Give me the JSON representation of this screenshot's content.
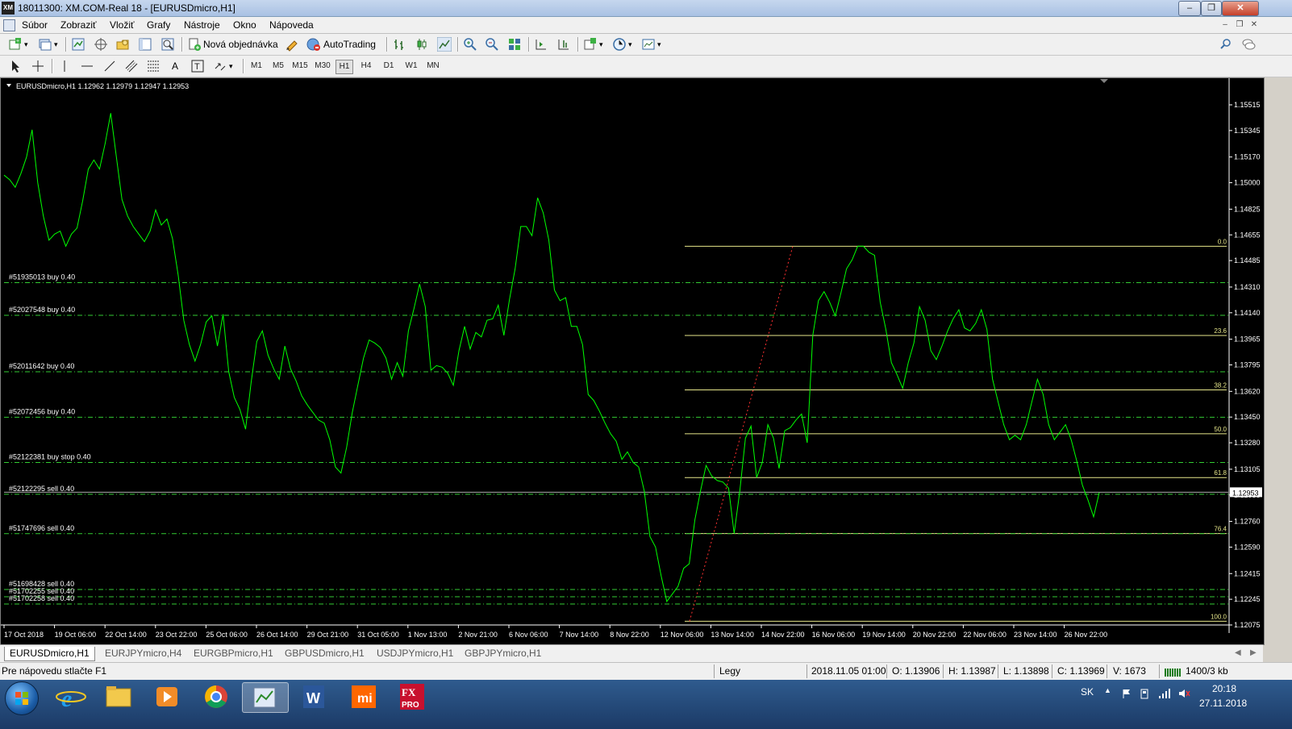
{
  "window": {
    "app_icon_text": "XM",
    "title": "18011300: XM.COM-Real 18 - [EURUSDmicro,H1]"
  },
  "menu": [
    "Súbor",
    "Zobraziť",
    "Vložiť",
    "Grafy",
    "Nástroje",
    "Okno",
    "Nápoveda"
  ],
  "toolbar": {
    "new_order_label": "Nová objednávka",
    "autotrading_label": "AutoTrading"
  },
  "timeframes": [
    "M1",
    "M5",
    "M15",
    "M30",
    "H1",
    "H4",
    "D1",
    "W1",
    "MN"
  ],
  "active_timeframe": "H1",
  "chart": {
    "header": "EURUSDmicro,H1  1.12962 1.12979 1.12947 1.12953",
    "background": "#000000",
    "price_color": "#00ff00",
    "order_line_color": "#33cc33",
    "fib_color": "#e6e68a",
    "current_price": "1.12953"
  },
  "chart_data": {
    "type": "line",
    "symbol": "EURUSDmicro",
    "timeframe": "H1",
    "ylim": [
      1.12075,
      1.15515
    ],
    "y_ticks": [
      "1.15515",
      "1.15345",
      "1.15170",
      "1.15000",
      "1.14825",
      "1.14655",
      "1.14485",
      "1.14310",
      "1.14140",
      "1.13965",
      "1.13795",
      "1.13620",
      "1.13450",
      "1.13280",
      "1.13105",
      "1.12935",
      "1.12760",
      "1.12590",
      "1.12415",
      "1.12245",
      "1.12075"
    ],
    "x_ticks": [
      "17 Oct 2018",
      "19 Oct 06:00",
      "22 Oct 14:00",
      "23 Oct 22:00",
      "25 Oct 06:00",
      "26 Oct 14:00",
      "29 Oct 21:00",
      "31 Oct 05:00",
      "1 Nov 13:00",
      "2 Nov 21:00",
      "6 Nov 06:00",
      "7 Nov 14:00",
      "8 Nov 22:00",
      "12 Nov 06:00",
      "13 Nov 14:00",
      "14 Nov 22:00",
      "16 Nov 06:00",
      "19 Nov 14:00",
      "20 Nov 22:00",
      "22 Nov 06:00",
      "23 Nov 14:00",
      "26 Nov 22:00"
    ],
    "close_path": [
      1.1505,
      1.1502,
      1.1497,
      1.1506,
      1.1517,
      1.1535,
      1.15,
      1.1478,
      1.1462,
      1.1466,
      1.1468,
      1.1458,
      1.1466,
      1.147,
      1.1488,
      1.1509,
      1.1515,
      1.1509,
      1.1526,
      1.1546,
      1.1517,
      1.1489,
      1.1478,
      1.1471,
      1.1466,
      1.1461,
      1.1468,
      1.1482,
      1.1472,
      1.1476,
      1.1463,
      1.1439,
      1.1409,
      1.1393,
      1.1382,
      1.1393,
      1.1408,
      1.1412,
      1.1392,
      1.1413,
      1.1375,
      1.1358,
      1.135,
      1.1337,
      1.1368,
      1.1395,
      1.1402,
      1.1386,
      1.1377,
      1.137,
      1.1392,
      1.1377,
      1.1369,
      1.1359,
      1.1353,
      1.1348,
      1.1343,
      1.1341,
      1.133,
      1.1312,
      1.1308,
      1.1325,
      1.1348,
      1.1366,
      1.1384,
      1.1396,
      1.1394,
      1.1391,
      1.1384,
      1.137,
      1.1381,
      1.1372,
      1.1402,
      1.1417,
      1.1433,
      1.1418,
      1.1376,
      1.1379,
      1.1378,
      1.1374,
      1.1366,
      1.1389,
      1.1405,
      1.139,
      1.1401,
      1.1398,
      1.1409,
      1.141,
      1.1419,
      1.1399,
      1.1423,
      1.1443,
      1.1471,
      1.1471,
      1.1465,
      1.149,
      1.148,
      1.1462,
      1.1429,
      1.1422,
      1.1424,
      1.1405,
      1.1405,
      1.1393,
      1.136,
      1.1356,
      1.1349,
      1.1341,
      1.1334,
      1.1329,
      1.1317,
      1.1322,
      1.1315,
      1.1312,
      1.1296,
      1.1266,
      1.1259,
      1.124,
      1.1223,
      1.1228,
      1.1233,
      1.1245,
      1.1248,
      1.1277,
      1.1296,
      1.1313,
      1.1306,
      1.1303,
      1.1302,
      1.1298,
      1.1268,
      1.1296,
      1.1331,
      1.1339,
      1.1305,
      1.1315,
      1.134,
      1.1331,
      1.1311,
      1.1336,
      1.1338,
      1.1343,
      1.1347,
      1.1328,
      1.1399,
      1.1422,
      1.1428,
      1.1421,
      1.1412,
      1.1427,
      1.1443,
      1.1449,
      1.1458,
      1.1458,
      1.1454,
      1.1452,
      1.1421,
      1.1403,
      1.1381,
      1.1373,
      1.1364,
      1.1381,
      1.1394,
      1.1418,
      1.1409,
      1.1389,
      1.1383,
      1.1392,
      1.1402,
      1.141,
      1.1416,
      1.1404,
      1.1402,
      1.1407,
      1.1416,
      1.1403,
      1.137,
      1.1355,
      1.134,
      1.133,
      1.1333,
      1.133,
      1.134,
      1.1355,
      1.137,
      1.136,
      1.134,
      1.133,
      1.1335,
      1.134,
      1.133,
      1.1316,
      1.13,
      1.129,
      1.1279,
      1.1295
    ]
  },
  "orders": [
    {
      "label": "#51935013 buy 0.40",
      "price": 1.14339
    },
    {
      "label": "#52027548 buy 0.40",
      "price": 1.14123
    },
    {
      "label": "#52011642 buy 0.40",
      "price": 1.1375
    },
    {
      "label": "#52072456 buy 0.40",
      "price": 1.13449
    },
    {
      "label": "#52122381 buy stop 0.40",
      "price": 1.1315
    },
    {
      "label": "#52122295 sell 0.40",
      "price": 1.1294
    },
    {
      "label": "#51747696 sell 0.40",
      "price": 1.12679
    },
    {
      "label": "#51698428 sell 0.40",
      "price": 1.1231
    },
    {
      "label": "#51702255 sell 0.40",
      "price": 1.12262
    },
    {
      "label": "#51702258 sell 0.40",
      "price": 1.12214
    }
  ],
  "fibonacci": [
    {
      "level": "0.0",
      "price": 1.1458
    },
    {
      "level": "23.6",
      "price": 1.1399
    },
    {
      "level": "38.2",
      "price": 1.1363
    },
    {
      "level": "50.0",
      "price": 1.1334
    },
    {
      "level": "61.8",
      "price": 1.1305
    },
    {
      "level": "76.4",
      "price": 1.1268
    },
    {
      "level": "100.0",
      "price": 1.121
    }
  ],
  "tabs": [
    "EURUSDmicro,H1",
    "EURJPYmicro,H4",
    "EURGBPmicro,H1",
    "GBPUSDmicro,H1",
    "USDJPYmicro,H1",
    "GBPJPYmicro,H1"
  ],
  "active_tab": "EURUSDmicro,H1",
  "status": {
    "help": "Pre nápovedu stlačte F1",
    "profile": "Legy",
    "datetime": "2018.11.05 01:00",
    "open": "O: 1.13906",
    "high": "H: 1.13987",
    "low": "L: 1.13898",
    "close": "C: 1.13969",
    "volume": "V: 1673",
    "traffic": "1400/3 kb"
  },
  "taskbar": {
    "lang": "SK",
    "time": "20:18",
    "date": "27.11.2018",
    "fxpro_text": "FX PRO",
    "xiaomi_text": "mi"
  }
}
